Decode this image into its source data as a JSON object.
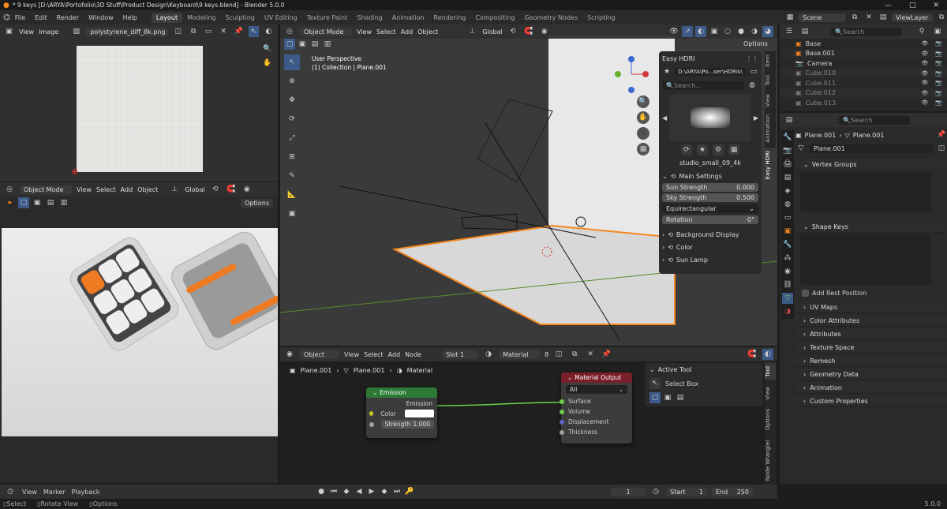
{
  "window": {
    "title": "* 9 keys [D:\\ARYA\\Portofolio\\3D Stuff\\Product Design\\Keyboard\\9 keys.blend] - Blender 5.0.0"
  },
  "menubar": {
    "items": [
      "File",
      "Edit",
      "Render",
      "Window",
      "Help"
    ]
  },
  "workspaces": [
    "Layout",
    "Modeling",
    "Sculpting",
    "UV Editing",
    "Texture Paint",
    "Shading",
    "Animation",
    "Rendering",
    "Compositing",
    "Geometry Nodes",
    "Scripting"
  ],
  "scene": {
    "name": "Scene",
    "view_layer": "ViewLayer"
  },
  "image_editor": {
    "menu": [
      "View",
      "Image"
    ],
    "image_name": "polystyrene_diff_8k.png"
  },
  "viewport_small": {
    "mode": "Object Mode",
    "menu": [
      "View",
      "Select",
      "Add",
      "Object"
    ],
    "orientation": "Global",
    "options": "Options"
  },
  "viewport_main": {
    "mode": "Object Mode",
    "menu": [
      "View",
      "Select",
      "Add",
      "Object"
    ],
    "orientation": "Global",
    "options": "Options",
    "overlay_line1": "User Perspective",
    "overlay_line2": "(1) Collection | Plane.001"
  },
  "easy_hdri": {
    "title": "Easy HDRI",
    "path": "D:\\ARYA\\Po...ser\\HDRIs\\",
    "search_placeholder": "Search...",
    "hdri_name": "studio_small_09_4k",
    "main_settings": "Main Settings",
    "sun_strength_label": "Sun Strength",
    "sun_strength": "0.000",
    "sky_strength_label": "Sky Strength",
    "sky_strength": "0.500",
    "projection": "Equirectangular",
    "rotation_label": "Rotation",
    "rotation": "0°",
    "sections": [
      "Background Display",
      "Color",
      "Sun Lamp"
    ]
  },
  "viewport_tabs": [
    "Item",
    "Tool",
    "View",
    "Animation",
    "Easy HDRI"
  ],
  "node_editor": {
    "type": "Object",
    "menu": [
      "View",
      "Select",
      "Add",
      "Node"
    ],
    "slot": "Slot 1",
    "material": "Material",
    "users": "8",
    "breadcrumb": [
      "Plane.001",
      "Plane.001",
      "Material"
    ]
  },
  "emission_node": {
    "title": "Emission",
    "output": "Emission",
    "color_label": "Color",
    "strength_label": "Strength",
    "strength": "1.000"
  },
  "material_output": {
    "title": "Material Output",
    "target": "All",
    "inputs": [
      "Surface",
      "Volume",
      "Displacement",
      "Thickness"
    ]
  },
  "active_tool": {
    "title": "Active Tool",
    "tool": "Select Box"
  },
  "node_tabs": [
    "Tool",
    "View",
    "Options",
    "Node Wrangler"
  ],
  "outliner": {
    "search_placeholder": "Search",
    "items": [
      "Base",
      "Base.001",
      "Camera",
      "Cube.010",
      "Cube.011",
      "Cube.012",
      "Cube.013"
    ]
  },
  "properties": {
    "search_placeholder": "Search",
    "object": "Plane.001",
    "data": "Plane.001",
    "mesh": "Plane.001",
    "sections": [
      "Vertex Groups",
      "Shape Keys"
    ],
    "add_rest_position": "Add Rest Position",
    "more_sections": [
      "UV Maps",
      "Color Attributes",
      "Attributes",
      "Texture Space",
      "Remesh",
      "Geometry Data",
      "Animation",
      "Custom Properties"
    ]
  },
  "timeline": {
    "menu": [
      "View",
      "Marker",
      "Playback"
    ],
    "current_frame": "1",
    "start_label": "Start",
    "start": "1",
    "end_label": "End",
    "end": "250"
  },
  "statusbar": {
    "items": [
      "Select",
      "Rotate View",
      "Options"
    ],
    "version": "5.0.0"
  },
  "colors": {
    "accent": "#4772b3",
    "orange": "#f5871f",
    "emission_header": "#2c7a35",
    "output_header": "#7a1f2a"
  }
}
